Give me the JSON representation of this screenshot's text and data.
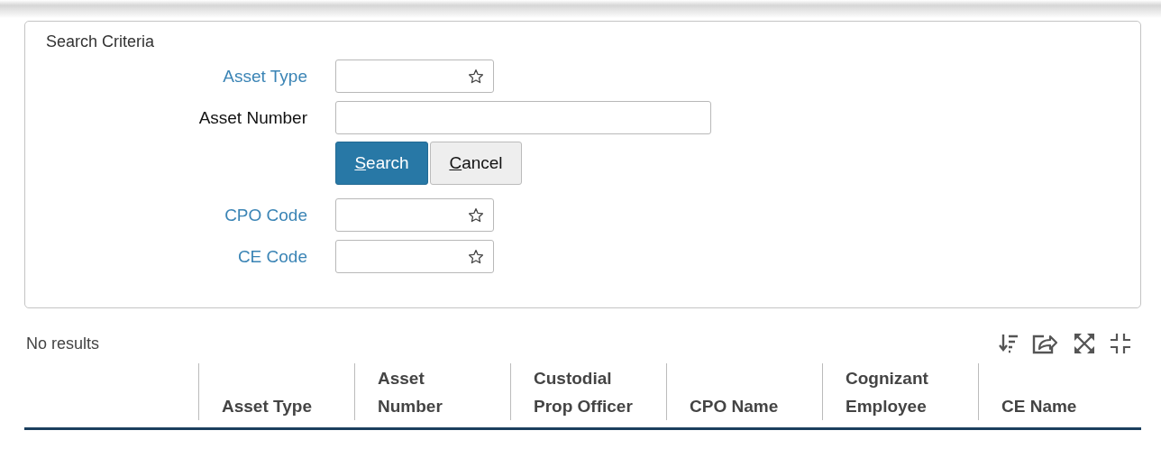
{
  "search_criteria": {
    "title": "Search Criteria",
    "fields": [
      {
        "kind": "lookup",
        "label": "Asset Type"
      },
      {
        "kind": "text",
        "label": "Asset Number"
      },
      {
        "kind": "buttons",
        "buttons": [
          {
            "kind": "primary",
            "label": "Search"
          },
          {
            "kind": "secondary",
            "label": "Cancel"
          }
        ]
      },
      {
        "kind": "lookup",
        "label": "CPO Code"
      },
      {
        "kind": "lookup",
        "label": "CE Code"
      }
    ]
  },
  "results": {
    "message": "No results"
  },
  "table": {
    "columns": [
      {
        "lines": [
          "Asset Type"
        ]
      },
      {
        "lines": [
          "Asset",
          "Number"
        ]
      },
      {
        "lines": [
          "Custodial",
          "Prop Officer"
        ]
      },
      {
        "lines": [
          "CPO Name"
        ]
      },
      {
        "lines": [
          "Cognizant",
          "Employee"
        ]
      },
      {
        "lines": [
          "CE Name"
        ]
      }
    ]
  }
}
